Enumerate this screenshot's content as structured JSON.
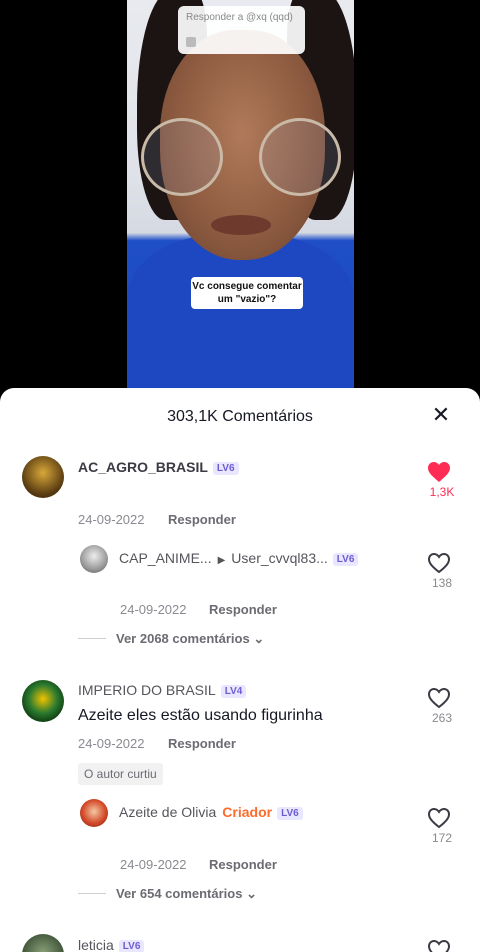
{
  "video": {
    "reply_to": "Responder a @xq (qqd)",
    "caption": "Vc consegue comentar um \"vazio\"?"
  },
  "sheet": {
    "title": "303,1K Comentários"
  },
  "comments": [
    {
      "user": "AC_AGRO_BRASIL",
      "level": "LV6",
      "date": "24-09-2022",
      "reply_label": "Responder",
      "likes": "1,3K",
      "liked": true,
      "reply": {
        "user": "CAP_ANIME...",
        "reply_to": "User_cvvql83...",
        "level": "LV6",
        "date": "24-09-2022",
        "reply_label": "Responder",
        "likes": "138"
      },
      "view_more": "Ver 2068 comentários"
    },
    {
      "user": "IMPERIO DO BRASIL",
      "level": "LV4",
      "text": "Azeite eles estão usando figurinha",
      "date": "24-09-2022",
      "reply_label": "Responder",
      "likes": "263",
      "badge": "O autor curtiu",
      "reply": {
        "user": "Azeite de Olivia",
        "creator_label": "Criador",
        "level": "LV6",
        "date": "24-09-2022",
        "reply_label": "Responder",
        "likes": "172"
      },
      "view_more": "Ver 654 comentários"
    },
    {
      "user": "leticia",
      "level": "LV6"
    }
  ],
  "colors": {
    "accent_red": "#fe2c55",
    "level_badge_bg": "#e9e7ff",
    "level_badge_text": "#6d5bd0",
    "creator": "#fe6b2c"
  }
}
